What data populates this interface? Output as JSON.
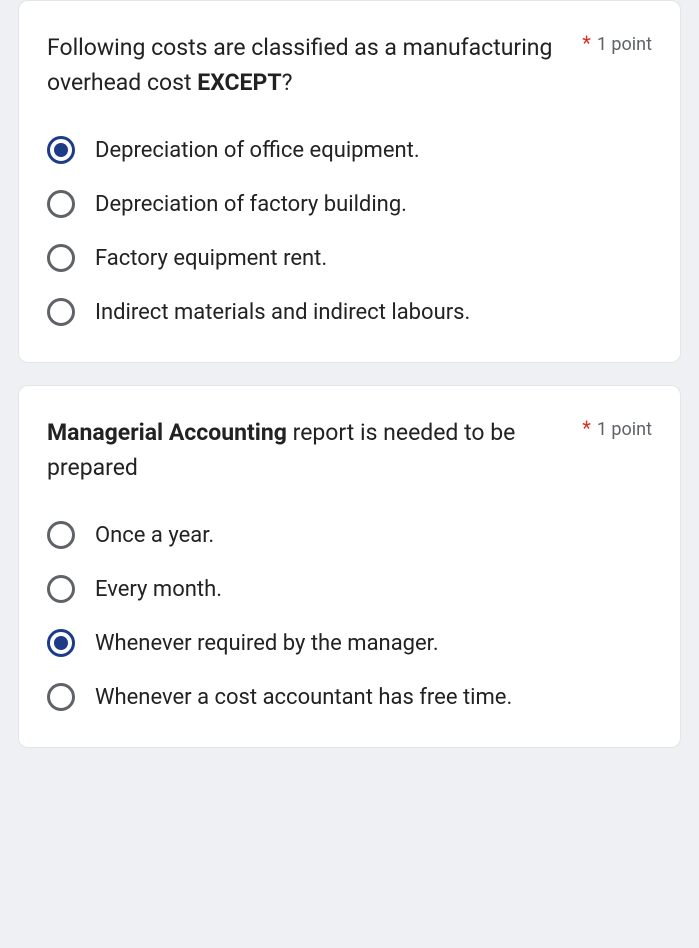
{
  "questions": [
    {
      "text_pre": "Following costs are classified as a manufacturing overhead cost ",
      "text_bold": "EXCEPT",
      "text_post": "?",
      "required_mark": "*",
      "points": "1 point",
      "options": [
        {
          "label": "Depreciation of office equipment.",
          "selected": true
        },
        {
          "label": "Depreciation of factory building.",
          "selected": false
        },
        {
          "label": "Factory equipment rent.",
          "selected": false
        },
        {
          "label": "Indirect materials and indirect labours.",
          "selected": false
        }
      ]
    },
    {
      "text_bold_lead": "Managerial Accounting",
      "text_rest": " report is needed to be prepared",
      "required_mark": "*",
      "points": "1 point",
      "options": [
        {
          "label": "Once a year.",
          "selected": false
        },
        {
          "label": "Every month.",
          "selected": false
        },
        {
          "label": "Whenever required by the manager.",
          "selected": true
        },
        {
          "label": "Whenever a cost accountant has free time.",
          "selected": false
        }
      ]
    }
  ]
}
